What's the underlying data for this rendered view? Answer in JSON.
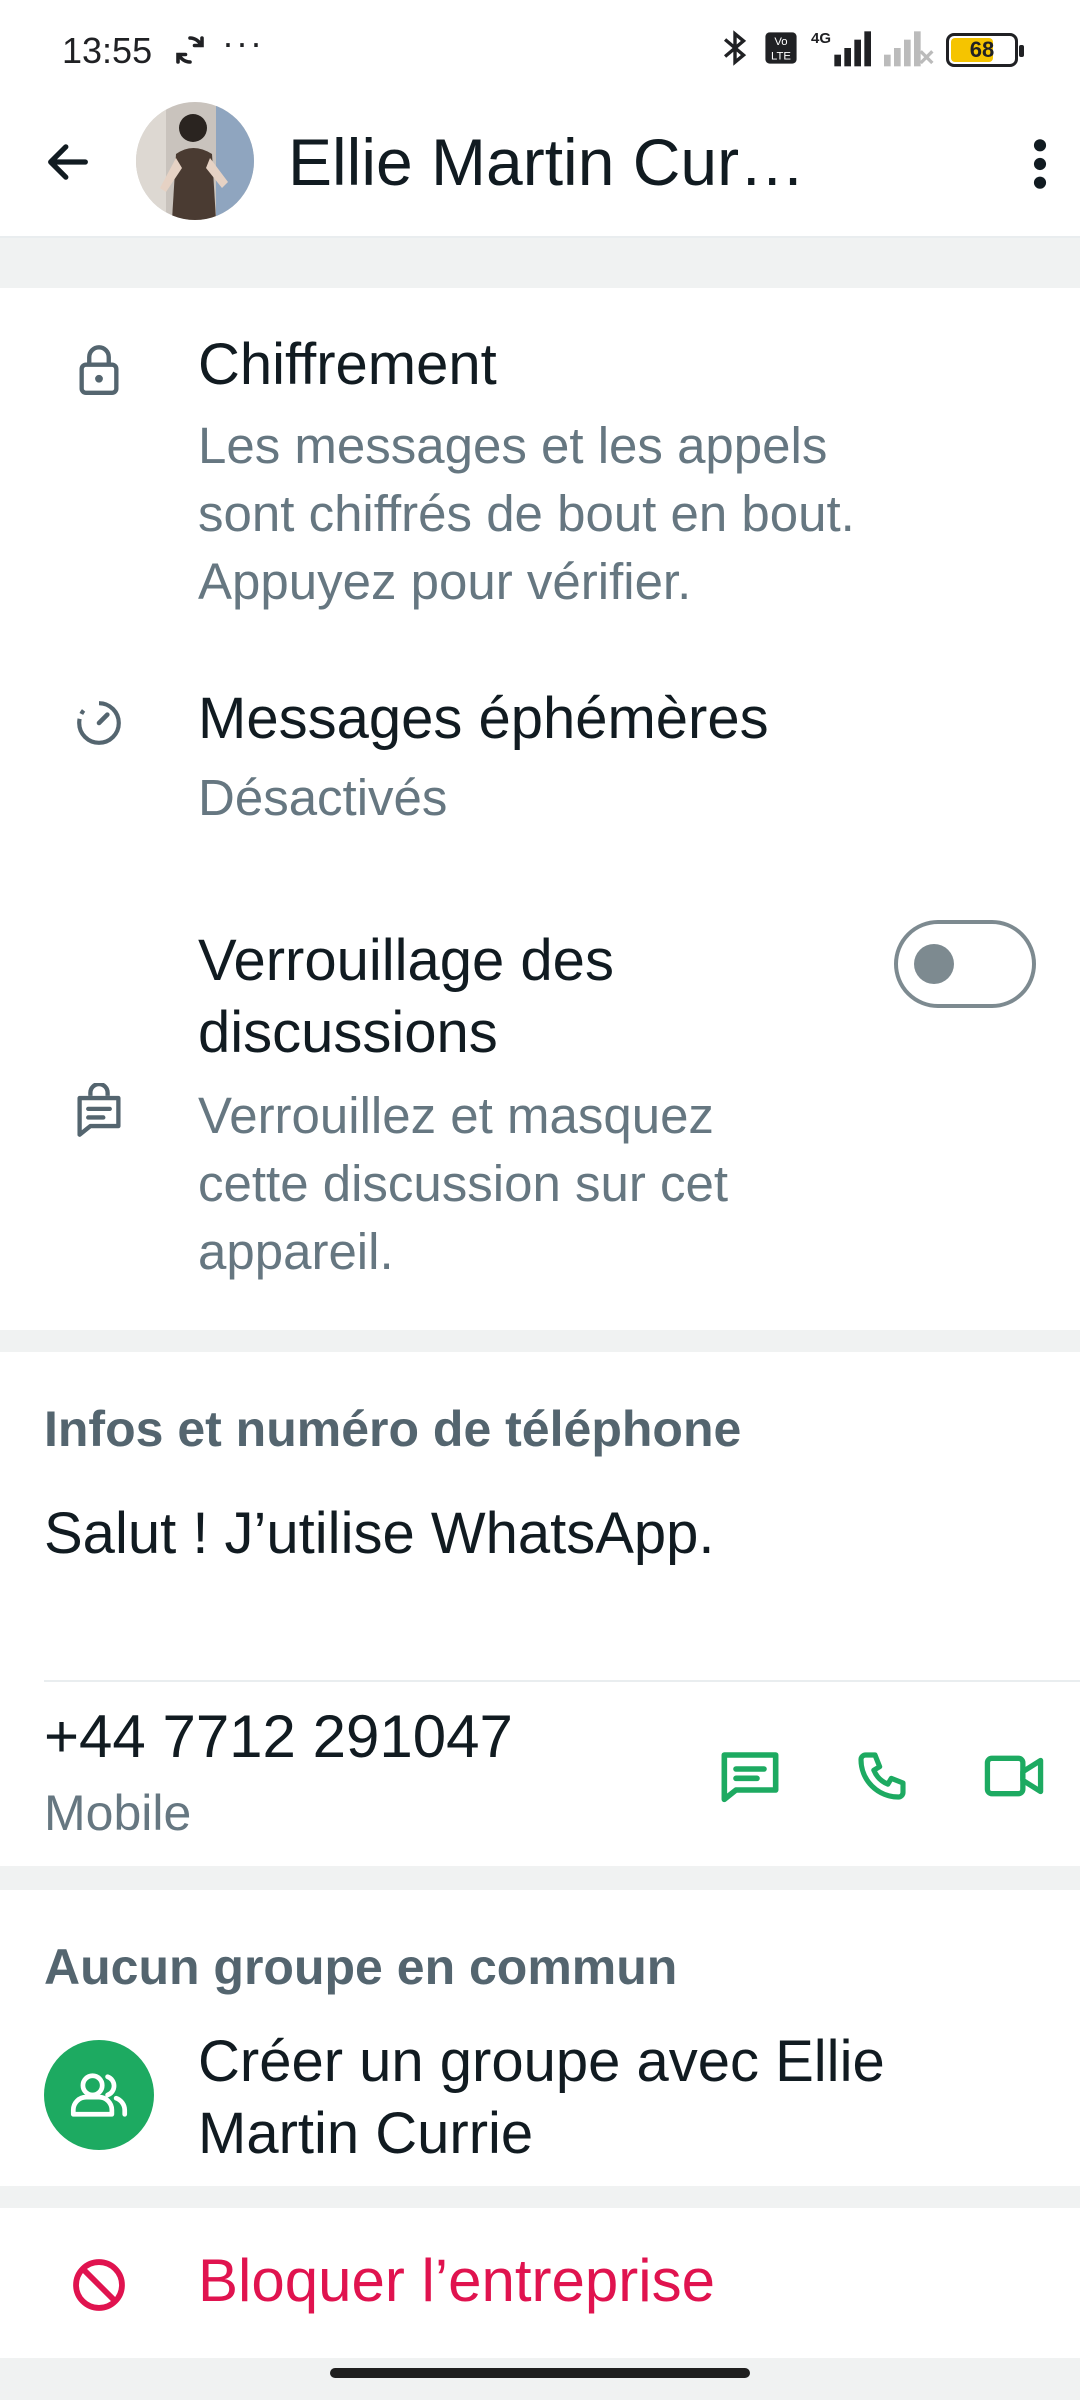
{
  "status_bar": {
    "time": "13:55",
    "overflow": "···",
    "battery_level": "68",
    "icons": [
      "sync-icon",
      "bluetooth-icon",
      "volte-icon",
      "signal-4g-icon",
      "signal-no-sim-icon",
      "battery-icon"
    ]
  },
  "header": {
    "contact_name": "Ellie Martin Cur…",
    "icons": [
      "back-arrow-icon",
      "avatar",
      "more-vert-icon"
    ]
  },
  "security": {
    "encryption": {
      "title": "Chiffrement",
      "line1": "Les messages et les appels",
      "line2": "sont chiffrés de bout en bout.",
      "line3": "Appuyez pour vérifier.",
      "icon": "lock-icon"
    },
    "disappearing": {
      "title": "Messages éphémères",
      "status": "Désactivés",
      "icon": "timer-icon"
    },
    "chat_lock": {
      "title_line1": "Verrouillage des",
      "title_line2": "discussions",
      "line1": "Verrouillez et masquez",
      "line2": "cette discussion sur cet",
      "line3": "appareil.",
      "enabled": false,
      "icon": "chat-lock-icon"
    }
  },
  "info": {
    "header": "Infos et numéro de téléphone",
    "about": "Salut ! J’utilise WhatsApp.",
    "phone": "+44 7712 291047",
    "phone_type": "Mobile",
    "actions": [
      "message-icon",
      "phone-icon",
      "video-call-icon"
    ]
  },
  "groups": {
    "header": "Aucun groupe en commun",
    "create_line1": "Créer un groupe avec Ellie",
    "create_line2": "Martin Currie",
    "icon": "group-icon"
  },
  "block": {
    "label": "Bloquer l’entreprise",
    "icon": "block-icon"
  },
  "colors": {
    "accent_green": "#1daa61",
    "danger_red": "#e0134f",
    "secondary_text": "#667781",
    "background": "#f0f2f2"
  }
}
